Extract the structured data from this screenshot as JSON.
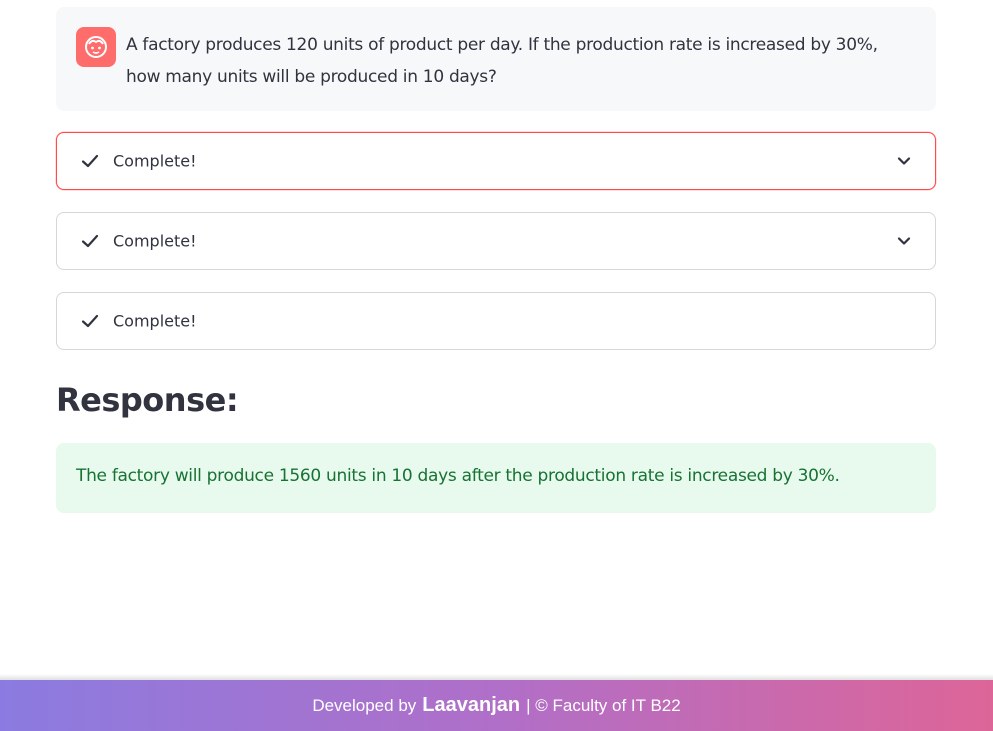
{
  "chat": {
    "question": "A factory produces 120 units of product per day. If the production rate is increased by 30%, how many units will be produced in 10 days?",
    "avatar_icon": "user-face-icon",
    "avatar_color": "#ff6c6c"
  },
  "statuses": [
    {
      "label": "Complete!",
      "expandable": true,
      "active": true
    },
    {
      "label": "Complete!",
      "expandable": true,
      "active": false
    },
    {
      "label": "Complete!",
      "expandable": false,
      "active": false
    }
  ],
  "response": {
    "heading": "Response:",
    "text": "The factory will produce 1560 units in 10 days after the production rate is increased by 30%.",
    "background": "#e8f9ee",
    "text_color": "#177233"
  },
  "footer": {
    "prefix": "Developed by",
    "author": "Laavanjan",
    "suffix": "| © Faculty of IT B22"
  },
  "colors": {
    "accent": "#ff4b4b",
    "footer_gradient_start": "#8b7be0",
    "footer_gradient_end": "#dd6598"
  }
}
